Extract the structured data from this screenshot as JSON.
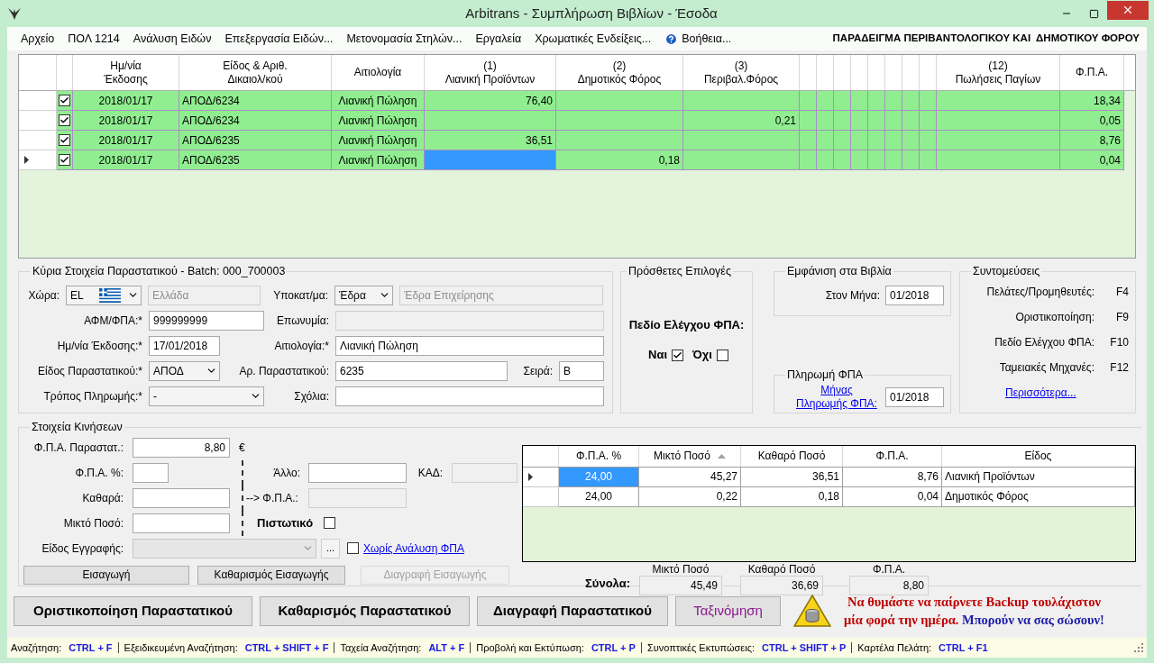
{
  "window": {
    "title": "Arbitrans - Συμπλήρωση Βιβλίων - Έσοδα"
  },
  "menu": [
    {
      "label": "Αρχείο",
      "kind": "plain"
    },
    {
      "label": "ΠΟΛ 1214",
      "kind": "plain"
    },
    {
      "label": "Ανάλυση Ειδών",
      "kind": "plain"
    },
    {
      "label": "Επεξεργασία Ειδών...",
      "kind": "plain"
    },
    {
      "label": "Μετονομασία Στηλών...",
      "kind": "plain"
    },
    {
      "label": "Εργαλεία",
      "kind": "plain"
    },
    {
      "label": "Χρωματικές Ενδείξεις...",
      "kind": "plain"
    },
    {
      "label": "Βοήθεια...",
      "kind": "help"
    }
  ],
  "banner": "ΠΑΡΑΔΕΙΓΜΑ ΠΕΡΙΒΑΝΤΟΛΟΓΙΚΟΥ ΚΑΙ  ΔΗΜΟΤΙΚΟΥ ΦΟΡΟΥ",
  "entries": {
    "columns": [
      {
        "lines": [
          "Ημ/νία",
          "Έκδοσης"
        ]
      },
      {
        "lines": [
          "Είδος & Αριθ.",
          "Δικαιολ/κού"
        ]
      },
      {
        "lines": [
          "Αιτιολογία"
        ]
      },
      {
        "lines": [
          "(1)",
          "Λιανική Προϊόντων"
        ]
      },
      {
        "lines": [
          "(2)",
          "Δημοτικός Φόρος"
        ]
      },
      {
        "lines": [
          "(3)",
          "Περιβαλ.Φόρος"
        ]
      },
      {
        "lines": [
          "(12)",
          "Πωλήσεις Παγίων"
        ]
      },
      {
        "lines": [
          "Φ.Π.Α."
        ]
      }
    ],
    "rows": [
      {
        "current": false,
        "checked": true,
        "cells": [
          {
            "text": "2018/01/17",
            "selected": false
          },
          {
            "text": "ΑΠΟΔ/6234",
            "selected": false
          },
          {
            "text": "Λιανική Πώληση",
            "selected": false
          },
          {
            "text": "76,40",
            "selected": false
          },
          {
            "selected": false
          },
          {
            "selected": false
          },
          {
            "selected": false
          },
          {
            "text": "18,34",
            "selected": false
          }
        ]
      },
      {
        "current": false,
        "checked": true,
        "cells": [
          {
            "text": "2018/01/17",
            "selected": false
          },
          {
            "text": "ΑΠΟΔ/6234",
            "selected": false
          },
          {
            "text": "Λιανική Πώληση",
            "selected": false
          },
          {
            "selected": false
          },
          {
            "selected": false
          },
          {
            "text": "0,21",
            "selected": false
          },
          {
            "selected": false
          },
          {
            "text": "0,05",
            "selected": false
          }
        ]
      },
      {
        "current": false,
        "checked": true,
        "cells": [
          {
            "text": "2018/01/17",
            "selected": false
          },
          {
            "text": "ΑΠΟΔ/6235",
            "selected": false
          },
          {
            "text": "Λιανική Πώληση",
            "selected": false
          },
          {
            "text": "36,51",
            "selected": false
          },
          {
            "selected": false
          },
          {
            "selected": false
          },
          {
            "selected": false
          },
          {
            "text": "8,76",
            "selected": false
          }
        ]
      },
      {
        "current": true,
        "checked": true,
        "cells": [
          {
            "text": "2018/01/17",
            "selected": false
          },
          {
            "text": "ΑΠΟΔ/6235",
            "selected": false
          },
          {
            "text": "Λιανική Πώληση",
            "selected": false
          },
          {
            "selected": true
          },
          {
            "text": "0,18",
            "selected": false
          },
          {
            "selected": false
          },
          {
            "selected": false
          },
          {
            "text": "0,04",
            "selected": false
          }
        ]
      }
    ]
  },
  "document": {
    "title": "Κύρια Στοιχεία Παραστατικού - Batch: 000_700003",
    "rows": [
      {
        "fields": [
          {
            "label": "Χώρα:",
            "kind": "flag_combo",
            "value": "EL",
            "disabled": false
          },
          {
            "kind": "text",
            "value": "Ελλάδα",
            "disabled": true
          },
          {
            "label": "Υποκατ/μα:",
            "kind": "combo",
            "value": "Έδρα",
            "disabled": false
          },
          {
            "kind": "text",
            "value": "Έδρα Επιχείρησης",
            "disabled": true
          }
        ]
      },
      {
        "fields": [
          {
            "label": "ΑΦΜ/ΦΠΑ:*",
            "kind": "text",
            "value": "999999999",
            "disabled": false
          },
          {
            "label": "Επωνυμία:",
            "kind": "text",
            "disabled": true
          }
        ]
      },
      {
        "fields": [
          {
            "label": "Ημ/νία Έκδοσης:*",
            "kind": "text",
            "value": "17/01/2018",
            "disabled": false
          },
          {
            "label": "Αιτιολογία:*",
            "kind": "text",
            "value": "Λιανική Πώληση",
            "disabled": false
          }
        ]
      },
      {
        "fields": [
          {
            "label": "Είδος Παραστατικού:*",
            "kind": "combo",
            "value": "ΑΠΟΔ",
            "disabled": false
          },
          {
            "label": "Αρ. Παραστατικού:",
            "kind": "text",
            "value": "6235",
            "disabled": false
          },
          {
            "label": "Σειρά:",
            "kind": "text",
            "value": "B",
            "disabled": false
          }
        ]
      },
      {
        "fields": [
          {
            "label": "Τρόπος Πληρωμής:*",
            "kind": "combo",
            "value": "-",
            "disabled": false
          },
          {
            "label": "Σχόλια:",
            "kind": "text",
            "disabled": false
          }
        ]
      }
    ]
  },
  "extras": {
    "title": "Πρόσθετες Επιλογές",
    "label": "Πεδίο Ελέγχου ΦΠΑ:",
    "options": [
      {
        "label": "Ναι",
        "checked": true
      },
      {
        "label": "Όχι",
        "checked": false
      }
    ]
  },
  "books": {
    "title": "Εμφάνιση στα Βιβλία",
    "label": "Στον Μήνα:",
    "value": "01/2018"
  },
  "vat_payment": {
    "title": "Πληρωμή ΦΠΑ",
    "link": "Μήνας Πληρωμής ΦΠΑ:",
    "value": "01/2018"
  },
  "shortcuts": {
    "title": "Συντομεύσεις",
    "items": [
      {
        "label": "Πελάτες/Προμηθευτές:",
        "key": "F4"
      },
      {
        "label": "Οριστικοποίηση:",
        "key": "F9"
      },
      {
        "label": "Πεδίο Ελέγχου ΦΠΑ:",
        "key": "F10"
      },
      {
        "label": "Ταμειακές Μηχανές:",
        "key": "F12"
      }
    ],
    "more": "Περισσότερα..."
  },
  "movements": {
    "title": "Στοιχεία Κινήσεων",
    "vat_total": {
      "label": "Φ.Π.Α. Παραστατ.:",
      "value": "8,80",
      "unit": "€"
    },
    "rate": {
      "label": "Φ.Π.Α. %:"
    },
    "net": {
      "label": "Καθαρά:"
    },
    "gross": {
      "label": "Μικτό Ποσό:"
    },
    "other": {
      "label": "Άλλο:"
    },
    "kad": {
      "label": "ΚΑΔ:",
      "disabled": true
    },
    "arrow_vat": {
      "label": "--> Φ.Π.Α.:",
      "disabled": true
    },
    "credit": {
      "label": "Πιστωτικό",
      "checked": false
    },
    "entry_type": {
      "label": "Είδος Εγγραφής:",
      "disabled": true
    },
    "browse": "...",
    "no_vat": {
      "label": "Χωρίς Ανάλυση ΦΠΑ",
      "checked": false
    },
    "buttons": [
      {
        "label": "Εισαγωγή",
        "disabled": false
      },
      {
        "label": "Καθαρισμός Εισαγωγής",
        "disabled": false
      },
      {
        "label": "Διαγραφή Εισαγωγής",
        "disabled": true
      }
    ]
  },
  "vat_grid": {
    "columns": [
      {
        "label": "Φ.Π.Α. %",
        "sorted": false
      },
      {
        "label": "Μικτό Ποσό",
        "sorted": true
      },
      {
        "label": "Καθαρό Ποσό",
        "sorted": false
      },
      {
        "label": "Φ.Π.Α.",
        "sorted": false
      },
      {
        "label": "Είδος",
        "sorted": false
      }
    ],
    "rows": [
      {
        "current": true,
        "cells": [
          {
            "text": "24,00",
            "selected": true
          },
          {
            "text": "45,27",
            "selected": false
          },
          {
            "text": "36,51",
            "selected": false
          },
          {
            "text": "8,76",
            "selected": false
          },
          {
            "text": "Λιανική Προϊόντων",
            "selected": false
          }
        ]
      },
      {
        "current": false,
        "cells": [
          {
            "text": "24,00",
            "selected": false
          },
          {
            "text": "0,22",
            "selected": false
          },
          {
            "text": "0,18",
            "selected": false
          },
          {
            "text": "0,04",
            "selected": false
          },
          {
            "text": "Δημοτικός Φόρος",
            "selected": false
          }
        ]
      }
    ]
  },
  "totals": {
    "label": "Σύνολα:",
    "items": [
      {
        "label": "Μικτό Ποσό",
        "value": "45,49"
      },
      {
        "label": "Καθαρό Ποσό",
        "value": "36,69"
      },
      {
        "label": "Φ.Π.Α.",
        "value": "8,80"
      }
    ]
  },
  "actions": [
    {
      "label": "Οριστικοποίηση Παραστατικού",
      "kind": "normal"
    },
    {
      "label": "Καθαρισμός Παραστατικού",
      "kind": "normal"
    },
    {
      "label": "Διαγραφή Παραστατικού",
      "kind": "normal"
    },
    {
      "label": "Ταξινόμηση",
      "kind": "accent"
    }
  ],
  "reminder": {
    "lines": [
      [
        {
          "text": "Να θυμάστε να παίρνετε Backup τουλάχιστον",
          "color": "#c00000"
        }
      ],
      [
        {
          "text": "μία φορά την ημέρα.",
          "color": "#c00000"
        },
        {
          "text": "Μπορούν να σας σώσουν!",
          "color": "#1c1ca8"
        }
      ]
    ]
  },
  "status_bar": [
    {
      "label": "Αναζήτηση:",
      "keys": "CTRL + F"
    },
    {
      "label": "Εξειδικευμένη Αναζήτηση:",
      "keys": "CTRL + SHIFT + F"
    },
    {
      "label": "Ταχεία Αναζήτηση:",
      "keys": "ALT + F"
    },
    {
      "label": "Προβολή και Εκτύπωση:",
      "keys": "CTRL + P"
    },
    {
      "label": "Συνοπτικές Εκτυπώσεις:",
      "keys": "CTRL + SHIFT + P"
    },
    {
      "label": "Καρτέλα Πελάτη:",
      "keys": "CTRL + F1"
    }
  ]
}
